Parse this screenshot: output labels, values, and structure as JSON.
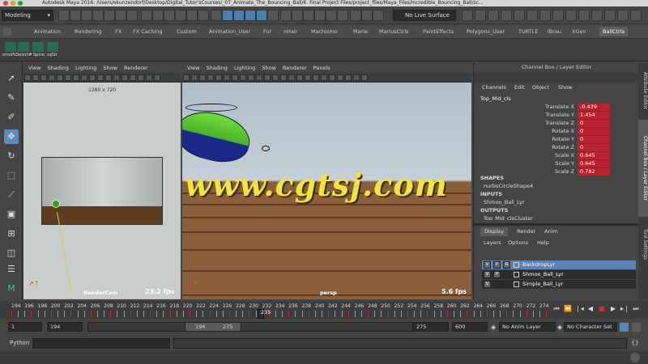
{
  "app": {
    "title": "Autodesk Maya 2016: /Users/ekunzendorf/Desktop/Digital_Tutor'sCourses/_07_Animate_The_Bouncing_Ball/6. Final Project Files/project_files/Maya_Files/Incredible_Bouncing_Ball/sc..."
  },
  "statusline": {
    "mode": "Modeling",
    "live_surface": "No Live Surface"
  },
  "shelf": {
    "tabs": [
      "Animation",
      "Rendering",
      "FX",
      "FX Caching",
      "Custom",
      "Animation_User",
      "Fur",
      "nHair",
      "Machismo",
      "Marie",
      "MariusCtrls",
      "PaintEffects",
      "Polygons_User",
      "TURTLE",
      "iBrau",
      "XGen",
      "BallCtrls"
    ],
    "active_tab": "BallCtrls",
    "buttons": [
      "emoPic",
      "Select#",
      "Spine",
      "sqStr"
    ]
  },
  "viewport_left": {
    "menu": [
      "View",
      "Shading",
      "Lighting",
      "Show",
      "Renderer"
    ],
    "resolution": "1280 x 720",
    "camera": "RenderCam",
    "fps": "23.2 fps"
  },
  "viewport_right": {
    "menu": [
      "View",
      "Shading",
      "Lighting",
      "Show",
      "Renderer",
      "Panels"
    ],
    "camera": "persp",
    "fps": "5.6 fps"
  },
  "watermark": "www.cgtsj.com",
  "channel_box": {
    "header": "Channel Box / Layer Editor",
    "menu": [
      "Channels",
      "Edit",
      "Object",
      "Show"
    ],
    "object": "Top_Mid_cls",
    "channels": [
      {
        "name": "Translate X",
        "value": "-0.439"
      },
      {
        "name": "Translate Y",
        "value": "1.454"
      },
      {
        "name": "Translate Z",
        "value": "0"
      },
      {
        "name": "Rotate X",
        "value": "0"
      },
      {
        "name": "Rotate Y",
        "value": "0"
      },
      {
        "name": "Rotate Z",
        "value": "0"
      },
      {
        "name": "Scale X",
        "value": "0.645"
      },
      {
        "name": "Scale Y",
        "value": "0.645"
      },
      {
        "name": "Scale Z",
        "value": "0.782"
      }
    ],
    "shapes_header": "SHAPES",
    "shapes_item": "nurbsCircleShape4",
    "inputs_header": "INPUTS",
    "inputs_item": "Shmoo_Ball_Lyr",
    "outputs_header": "OUTPUTS",
    "outputs_item": "Top_Mid_clsCluster"
  },
  "layer_editor": {
    "tabs": [
      "Display",
      "Render",
      "Anim"
    ],
    "active_tab": "Display",
    "menu": [
      "Layers",
      "Options",
      "Help"
    ],
    "layers": [
      {
        "v": "V",
        "p": "P",
        "r": "R",
        "name": "BackdropLyr",
        "selected": true
      },
      {
        "v": "V",
        "p": "P",
        "r": "",
        "name": "Shmoo_Ball_Lyr",
        "selected": false
      },
      {
        "v": "V",
        "p": "",
        "r": "",
        "name": "Simple_Ball_Lyr",
        "selected": false
      }
    ]
  },
  "side_tabs": [
    "Attribute Editor",
    "Channel Box / Layer Editor",
    "Tool Settings"
  ],
  "timeline": {
    "labels": [
      "194",
      "196",
      "198",
      "200",
      "202",
      "204",
      "206",
      "208",
      "210",
      "212",
      "214",
      "216",
      "218",
      "220",
      "222",
      "224",
      "226",
      "228",
      "230",
      "232",
      "234",
      "236",
      "238",
      "240",
      "242",
      "244",
      "246",
      "248",
      "250",
      "252",
      "254",
      "256",
      "258",
      "260",
      "262",
      "264",
      "266",
      "268",
      "270",
      "272",
      "274"
    ],
    "current_frame": "235",
    "key_color": "#c8232e"
  },
  "range": {
    "start": "1",
    "anim_start": "194",
    "range_start": "194",
    "range_end": "275",
    "anim_end": "275",
    "end": "600",
    "anim_layer": "No Anim Layer",
    "character_set": "No Character Set"
  },
  "command": {
    "language": "Python"
  }
}
